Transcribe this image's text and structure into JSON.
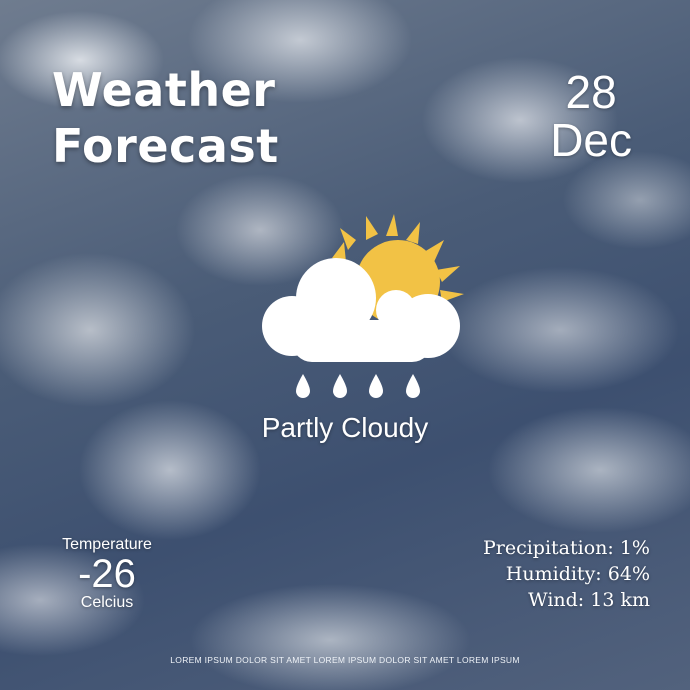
{
  "title": {
    "line1": "Weather",
    "line2": "Forecast"
  },
  "date": {
    "day": "28",
    "month": "Dec"
  },
  "icon": {
    "name": "partly-cloudy-rain-icon",
    "sun_color": "#F2C245",
    "cloud_color": "#FFFFFF"
  },
  "condition": "Partly Cloudy",
  "temperature": {
    "label": "Temperature",
    "value": "-26",
    "unit": "Celcius"
  },
  "stats": [
    {
      "label": "Precipitation:",
      "value": "1%"
    },
    {
      "label": "Humidity:",
      "value": "64%"
    },
    {
      "label": "Wind:",
      "value": "13 km"
    }
  ],
  "footer": "LOREM IPSUM DOLOR SIT AMET LOREM IPSUM DOLOR SIT AMET LOREM IPSUM"
}
